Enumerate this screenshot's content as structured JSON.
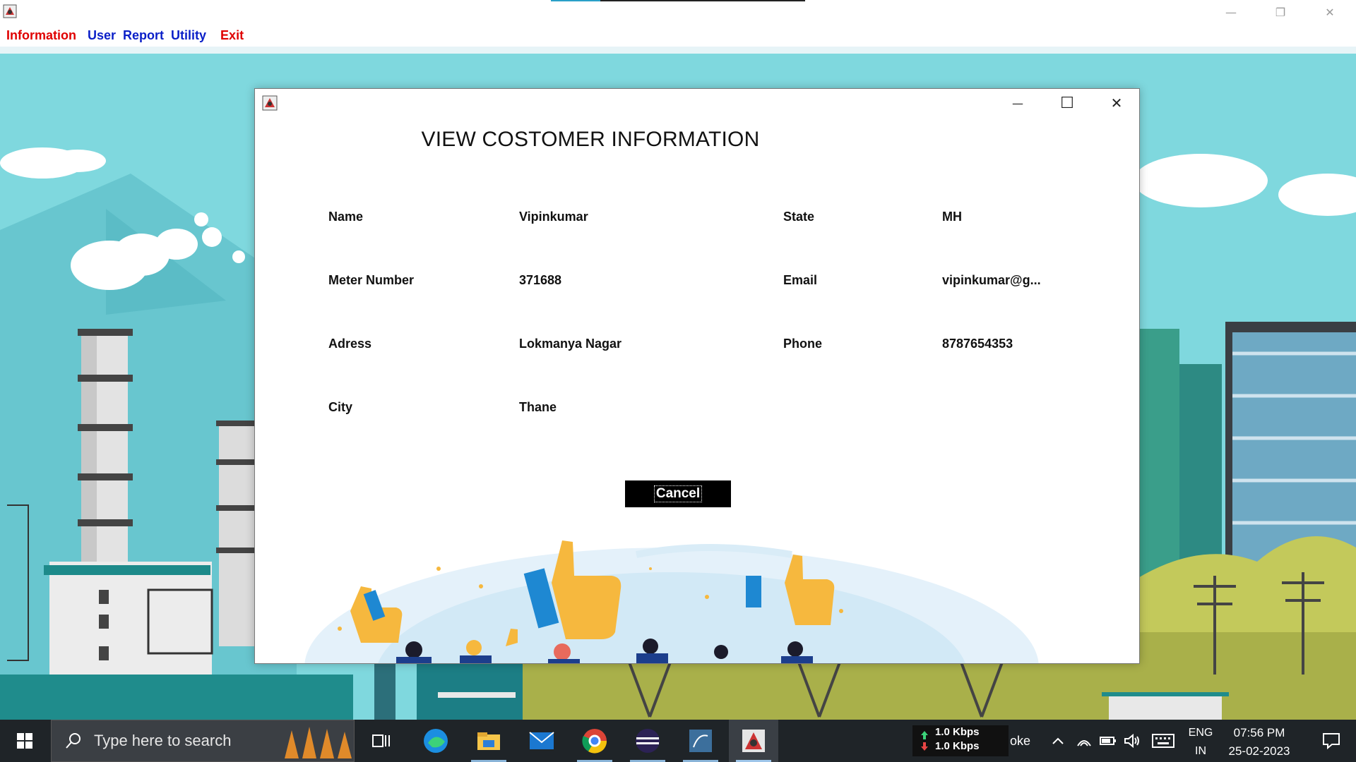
{
  "main_window": {
    "menu": [
      {
        "label": "Information",
        "color": "#e00000"
      },
      {
        "label": "User",
        "color": "#0a1fc8"
      },
      {
        "label": "Report",
        "color": "#0a1fc8"
      },
      {
        "label": "Utility",
        "color": "#0a1fc8"
      },
      {
        "label": "Exit",
        "color": "#e00000"
      }
    ],
    "controls": {
      "minimize": "—",
      "restore": "❐",
      "close": "✕"
    }
  },
  "dialog": {
    "title": "VIEW COSTOMER INFORMATION",
    "controls": {
      "minimize": "—",
      "maximize": "☐",
      "close": "✕"
    },
    "fields": {
      "name": {
        "label": "Name",
        "value": "Vipinkumar"
      },
      "meter": {
        "label": "Meter Number",
        "value": "371688"
      },
      "address": {
        "label": "Adress",
        "value": "Lokmanya Nagar"
      },
      "city": {
        "label": "City",
        "value": "Thane"
      },
      "state": {
        "label": "State",
        "value": "MH"
      },
      "email": {
        "label": "Email",
        "value": "vipinkumar@g..."
      },
      "phone": {
        "label": "Phone",
        "value": "8787654353"
      }
    },
    "cancel_label": "Cancel"
  },
  "taskbar": {
    "search_placeholder": "Type here to search",
    "apps": [
      "task-view-icon",
      "edge-icon",
      "file-explorer-icon",
      "mail-icon",
      "chrome-icon",
      "eclipse-icon",
      "mysql-workbench-icon",
      "java-app-icon"
    ],
    "network": {
      "download": "1.0 Kbps",
      "upload": "1.0 Kbps"
    },
    "partial_text": "oke",
    "language": {
      "lang": "ENG",
      "region": "IN"
    },
    "time": "07:56 PM",
    "date": "25-02-2023"
  },
  "colors": {
    "sky": "#7fd8de",
    "dialog_button": "#000000",
    "taskbar": "#1f2428"
  }
}
